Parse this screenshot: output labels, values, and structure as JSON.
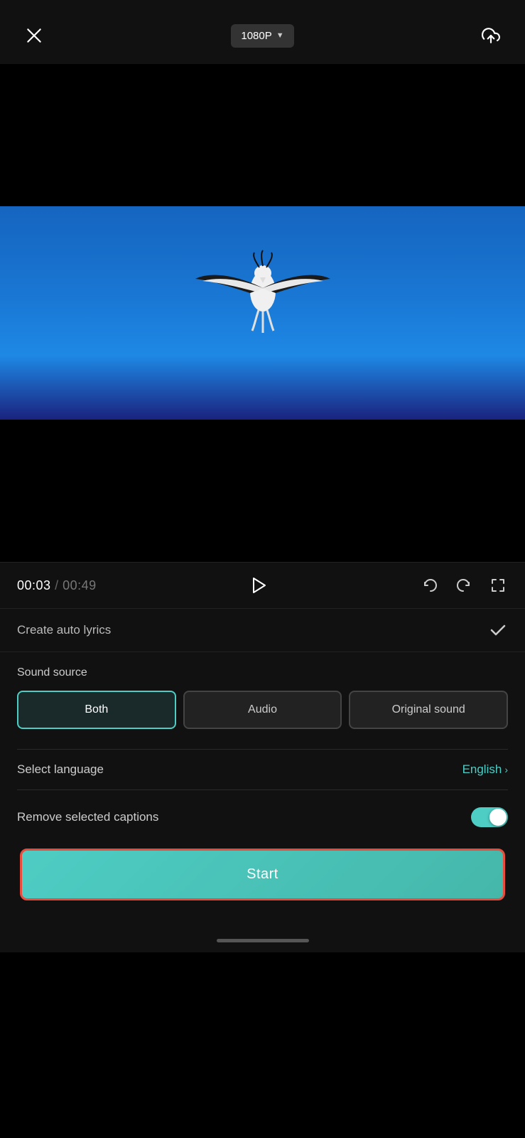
{
  "topBar": {
    "resolution": "1080P",
    "resolutionArrow": "▼"
  },
  "playback": {
    "currentTime": "00:03",
    "separator": " / ",
    "totalTime": "00:49"
  },
  "autoLyrics": {
    "label": "Create auto lyrics"
  },
  "soundSource": {
    "sectionLabel": "Sound source",
    "buttons": [
      {
        "id": "both",
        "label": "Both",
        "active": true
      },
      {
        "id": "audio",
        "label": "Audio",
        "active": false
      },
      {
        "id": "original",
        "label": "Original sound",
        "active": false
      }
    ]
  },
  "language": {
    "label": "Select language",
    "value": "English",
    "chevron": "›"
  },
  "removeCaptions": {
    "label": "Remove selected captions"
  },
  "startButton": {
    "label": "Start"
  },
  "colors": {
    "accent": "#4ecdc4",
    "danger": "#e74c3c",
    "inactive": "#444"
  }
}
